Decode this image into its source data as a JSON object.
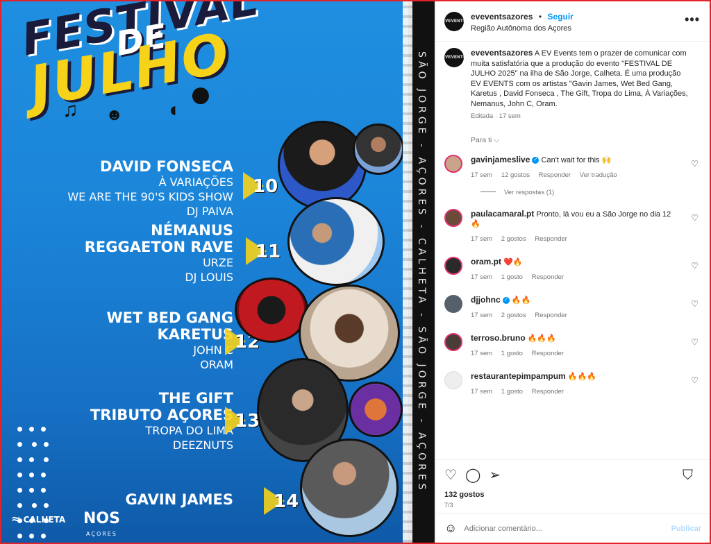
{
  "poster": {
    "title_line1": "FESTIVAL",
    "title_line2": "DE",
    "title_line3": "JULHO",
    "strip_text": "SÃO JORGE - AÇORES - CALHETA - SÃO JORGE - AÇORES",
    "days": [
      {
        "num": "10",
        "headliners": [
          "DAVID FONSECA"
        ],
        "others": [
          "À VARIAÇÕES",
          "WE ARE THE 90'S KIDS SHOW",
          "DJ PAIVA"
        ]
      },
      {
        "num": "11",
        "headliners": [
          "NÉMANUS",
          "REGGAETON RAVE"
        ],
        "others": [
          "URZE",
          "DJ LOUIS"
        ]
      },
      {
        "num": "12",
        "headliners": [
          "WET BED GANG",
          "KARETUS"
        ],
        "others": [
          "JOHN C",
          "ORAM"
        ]
      },
      {
        "num": "13",
        "headliners": [
          "THE GIFT",
          "TRIBUTO AÇORES"
        ],
        "others": [
          "TROPA DO LIMA",
          "DEEZNUTS"
        ]
      },
      {
        "num": "14",
        "headliners": [
          "GAVIN JAMES"
        ],
        "others": []
      }
    ],
    "logo_calheta": "CALHETA",
    "logo_nos": "NOS",
    "logo_nos_sub": "AÇORES"
  },
  "header": {
    "avatar_text": "EVEVENTS",
    "username": "eveventsazores",
    "sep": "•",
    "follow": "Seguir",
    "location": "Região Autônoma dos Açores",
    "more": "•••"
  },
  "caption": {
    "username": "eveventsazores",
    "text": "A EV Events tem o prazer de comunicar com muita satisfatória que a produção do evento \"FESTIVAL DE JULHO 2025\" na ilha de São Jorge, Calheta. É uma produção EV EVENTS com os artistas \"Gavin James, Wet Bed Gang, Karetus , David Fonseca , The Gift, Tropa do Lima, À Variações, Nemanus, John C, Oram.",
    "time": "Editada · 17 sem"
  },
  "for_you": "Para ti ⌵",
  "comments": [
    {
      "user": "gavinjameslive",
      "verified": true,
      "text": "Can't wait for this 🙌",
      "time": "17 sem",
      "likes": "12 gostos",
      "reply": "Responder",
      "translate": "Ver tradução",
      "av_color": "#c9a48a"
    },
    {
      "user": "paulacamaral.pt",
      "verified": false,
      "text": "Pronto, lá vou eu a São Jorge no dia 12 🔥",
      "time": "17 sem",
      "likes": "2 gostos",
      "reply": "Responder",
      "translate": "",
      "av_color": "#6b4a3a"
    },
    {
      "user": "oram.pt",
      "verified": false,
      "text": "❤️🔥",
      "time": "17 sem",
      "likes": "1 gosto",
      "reply": "Responder",
      "translate": "",
      "av_color": "#2a2a2a"
    },
    {
      "user": "djjohnc",
      "verified": true,
      "text": "🔥🔥",
      "time": "17 sem",
      "likes": "2 gostos",
      "reply": "Responder",
      "translate": "",
      "av_color": "#55606a"
    },
    {
      "user": "terroso.bruno",
      "verified": false,
      "text": "🔥🔥🔥",
      "time": "17 sem",
      "likes": "1 gosto",
      "reply": "Responder",
      "translate": "",
      "av_color": "#4a3c36"
    },
    {
      "user": "restaurantepimpampum",
      "verified": false,
      "text": "🔥🔥🔥",
      "time": "17 sem",
      "likes": "1 gosto",
      "reply": "Responder",
      "translate": "",
      "av_color": "#eeeeee"
    }
  ],
  "view_replies": "Ver respostas (1)",
  "actions": {
    "likes": "132 gostos",
    "page": "7/3"
  },
  "add_comment": {
    "placeholder": "Adicionar comentário...",
    "post": "Publicar"
  }
}
